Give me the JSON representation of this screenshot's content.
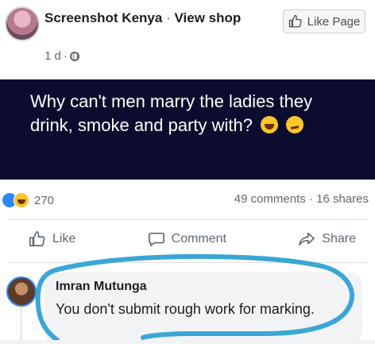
{
  "post": {
    "author": "Screenshot Kenya",
    "separator": "·",
    "author_link": "View shop",
    "time": "1 d",
    "time_dot": "·",
    "like_page_label": "Like Page",
    "body": "Why can't men marry the ladies they drink, smoke and party with?",
    "emojis": [
      "laughing-face-icon",
      "thinking-face-icon"
    ]
  },
  "engagement": {
    "reaction_icons": [
      "like-reaction-icon",
      "haha-reaction-icon"
    ],
    "reaction_count": "270",
    "comments": "49 comments",
    "stats_dot": "·",
    "shares": "16 shares"
  },
  "actions": {
    "like": "Like",
    "comment": "Comment",
    "share": "Share"
  },
  "comment": {
    "author": "Imran Mutunga",
    "text": "You don't submit rough work for marking."
  },
  "colors": {
    "post_background": "#0c0d2e",
    "annotation": "#3aa6d6",
    "facebook_blue": "#2d88ff"
  }
}
